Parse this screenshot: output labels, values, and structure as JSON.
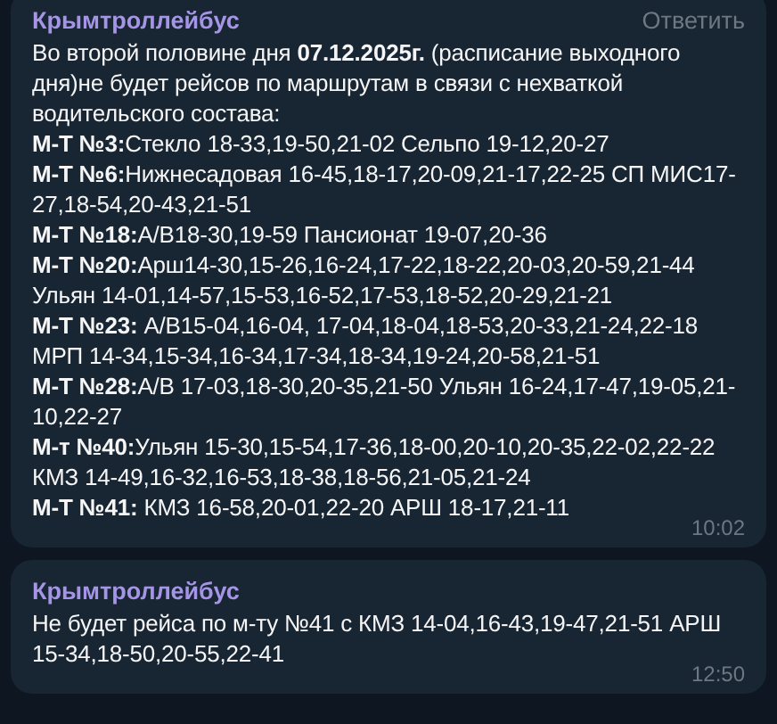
{
  "messages": [
    {
      "sender": "Крымтроллейбус",
      "reply": "Ответить",
      "time": "10:02",
      "lines": [
        "Во второй половине дня **07.12.2025г.** (расписание выходного дня)не будет рейсов по маршрутам в связи с нехваткой водительского состава:",
        "**М-Т №3:**Стекло 18-33,19-50,21-02 Сельпо 19-12,20-27",
        "**М-Т №6:**Нижнесадовая 16-45,18-17,20-09,21-17,22-25 СП МИС17-27,18-54,20-43,21-51",
        "**М-Т №18:**А/В18-30,19-59 Пансионат 19-07,20-36",
        "**М-Т №20:**Арш14-30,15-26,16-24,17-22,18-22,20-03,20-59,21-44  Ульян 14-01,14-57,15-53,16-52,17-53,18-52,20-29,21-21",
        "**М-Т №23:** А/В15-04,16-04, 17-04,18-04,18-53,20-33,21-24,22-18 МРП 14-34,15-34,16-34,17-34,18-34,19-24,20-58,21-51",
        "**М-Т №28:**А/В 17-03,18-30,20-35,21-50 Ульян 16-24,17-47,19-05,21-10,22-27",
        "**М-т №40:**Ульян 15-30,15-54,17-36,18-00,20-10,20-35,22-02,22-22 КМЗ 14-49,16-32,16-53,18-38,18-56,21-05,21-24",
        "**М-Т №41:** КМЗ 16-58,20-01,22-20 АРШ 18-17,21-11"
      ]
    },
    {
      "sender": "Крымтроллейбус",
      "time": "12:50",
      "lines": [
        "Не будет рейса по м-ту №41 с КМЗ 14-04,16-43,19-47,21-51 АРШ 15-34,18-50,20-55,22-41"
      ]
    }
  ]
}
